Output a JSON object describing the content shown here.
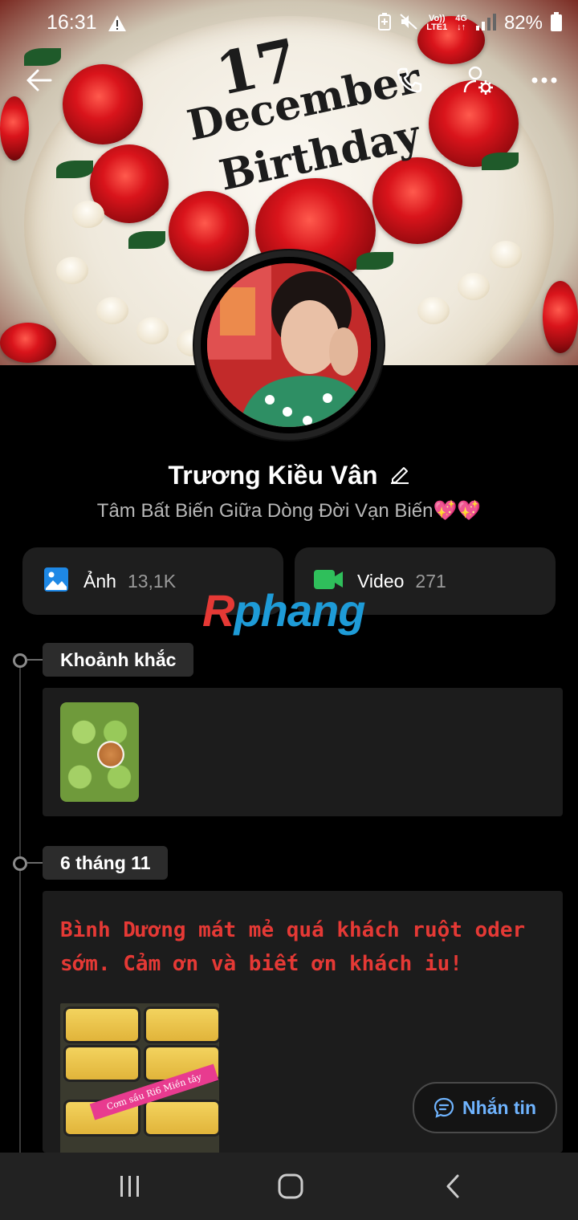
{
  "status_bar": {
    "time": "16:31",
    "network_top": "Vo))",
    "network_bottom": "LTE1",
    "network_type": "4G",
    "battery": "82%"
  },
  "cover": {
    "cake_text_day": "17",
    "cake_text_month": "December",
    "cake_text_event": "Birthday"
  },
  "profile": {
    "name": "Trương Kiều Vân",
    "bio": "Tâm Bất Biến Giữa Dòng Đời Vạn Biến💖💖"
  },
  "media": {
    "photos_label": "Ảnh",
    "photos_count": "13,1K",
    "videos_label": "Video",
    "videos_count": "271"
  },
  "watermark": {
    "first": "R",
    "rest": "phang"
  },
  "timeline": [
    {
      "label": "Khoảnh khắc"
    },
    {
      "label": "6 tháng 11",
      "text": "Bình Dương mát mẻ quá khách ruột oder sớm. Cảm ơn và biết ơn khách iu!",
      "image_tag": "Cơm sầu Ri6 Miền tây"
    }
  ],
  "message_button": "Nhắn tin",
  "colors": {
    "accent_blue": "#6fb4ff",
    "post_text_red": "#e53935",
    "photo_icon_blue": "#1e88e5",
    "video_icon_green": "#2fbf5b"
  },
  "icons": [
    "back-arrow-icon",
    "phone-icon",
    "profile-settings-icon",
    "more-icon",
    "edit-pencil-icon",
    "photo-icon",
    "video-camera-icon",
    "chat-icon",
    "recents-icon",
    "home-icon",
    "back-nav-icon"
  ]
}
